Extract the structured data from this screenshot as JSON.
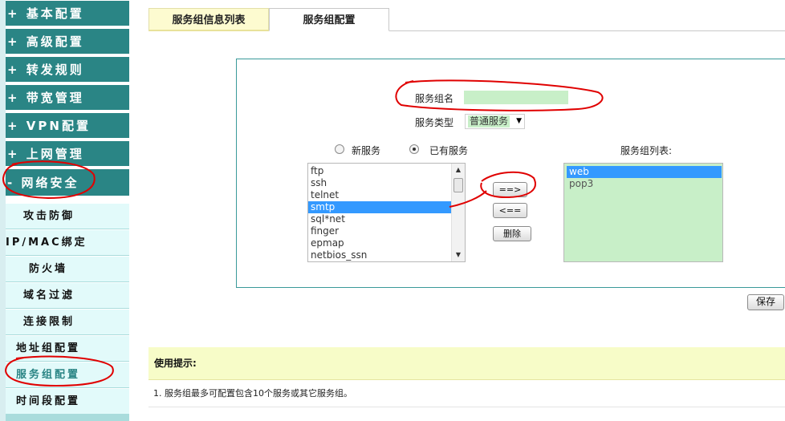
{
  "sidebar": {
    "main_items": [
      {
        "label": "+ 基本配置"
      },
      {
        "label": "+ 高级配置"
      },
      {
        "label": "+ 转发规则"
      },
      {
        "label": "+ 带宽管理"
      },
      {
        "label": "+ VPN配置"
      },
      {
        "label": "+ 上网管理"
      },
      {
        "label": "- 网络安全"
      }
    ],
    "sub_items": [
      {
        "label": "攻击防御"
      },
      {
        "label": "IP/MAC绑定"
      },
      {
        "label": "防火墙"
      },
      {
        "label": "域名过滤"
      },
      {
        "label": "连接限制"
      },
      {
        "label": "地址组配置"
      },
      {
        "label": "服务组配置"
      },
      {
        "label": "时间段配置"
      }
    ]
  },
  "tabs": [
    {
      "label": "服务组信息列表"
    },
    {
      "label": "服务组配置"
    }
  ],
  "form": {
    "group_name_label": "服务组名",
    "group_name_value": "",
    "service_type_label": "服务类型",
    "service_type_value": "普通服务",
    "radio_new_label": "新服务",
    "radio_existing_label": "已有服务",
    "group_list_label": "服务组列表:",
    "services": [
      "ftp",
      "ssh",
      "telnet",
      "smtp",
      "sql*net",
      "finger",
      "epmap",
      "netbios_ssn"
    ],
    "selected_service": "smtp",
    "group_services": [
      "web",
      "pop3"
    ],
    "selected_group_service": "web",
    "add_button": "==>",
    "remove_button": "<==",
    "delete_button": "删除"
  },
  "save_button": "保存",
  "tips": {
    "title": "使用提示:",
    "items": [
      "1. 服务组最多可配置包含10个服务或其它服务组。"
    ]
  },
  "colors": {
    "sidebar_main": "#2a8585",
    "sidebar_sub": "#e2fafa",
    "input_bg": "#c8efc8",
    "selection": "#3399ff",
    "tips_bg": "#f7fcc8",
    "panel_border": "#3a9a9a",
    "annotation": "#e00000"
  }
}
